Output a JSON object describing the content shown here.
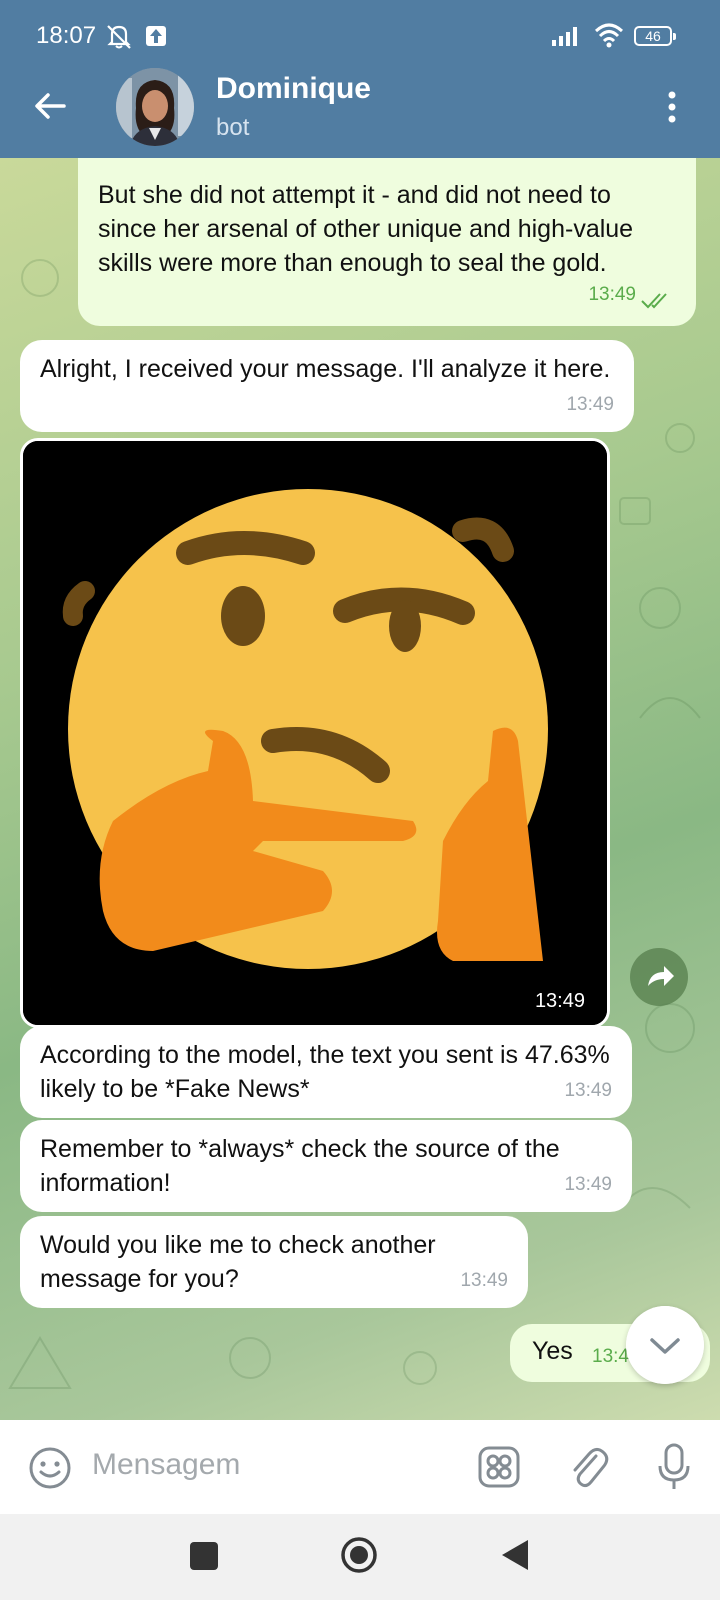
{
  "status_bar": {
    "time": "18:07",
    "battery": "46"
  },
  "header": {
    "title": "Dominique",
    "subtitle": "bot"
  },
  "messages": [
    {
      "dir": "out",
      "text": "But she did not attempt it - and did not need to since her arsenal of other unique and high-value skills were more than enough to seal the gold.",
      "time": "13:49",
      "status": "read"
    },
    {
      "dir": "in",
      "text": "Alright, I received your message. I'll analyze it here.",
      "time": "13:49"
    },
    {
      "dir": "in",
      "type": "image",
      "icon": "thinking-face-emoji",
      "time": "13:49"
    },
    {
      "dir": "in",
      "text": "According to the model, the text you sent is 47.63% likely to be *Fake News*",
      "time": "13:49"
    },
    {
      "dir": "in",
      "text": "Remember to *always* check the source of the information!",
      "time": "13:49"
    },
    {
      "dir": "in",
      "text": "Would you like me to check another message for you?",
      "time": "13:49"
    },
    {
      "dir": "out",
      "text": "Yes",
      "time": "13:4"
    }
  ],
  "composer": {
    "placeholder": "Mensagem"
  }
}
